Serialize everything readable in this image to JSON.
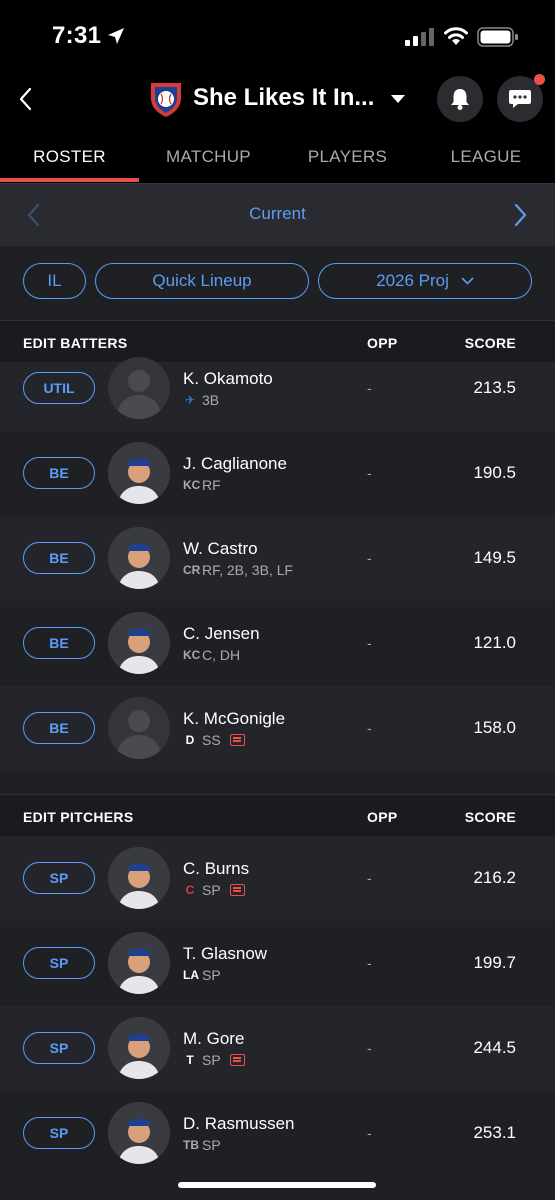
{
  "status_bar": {
    "time": "7:31"
  },
  "header": {
    "team_name": "She Likes It In..."
  },
  "tabs": [
    {
      "label": "ROSTER",
      "active": true
    },
    {
      "label": "MATCHUP",
      "active": false
    },
    {
      "label": "PLAYERS",
      "active": false
    },
    {
      "label": "LEAGUE",
      "active": false
    }
  ],
  "period": {
    "label": "Current"
  },
  "controls": {
    "il": "IL",
    "quick_lineup": "Quick Lineup",
    "projection": "2026 Proj"
  },
  "batters": {
    "header": {
      "title": "EDIT BATTERS",
      "opp": "OPP",
      "score": "SCORE"
    },
    "rows": [
      {
        "slot": "UTIL",
        "name": "K. Okamoto",
        "team": "TOR",
        "positions": "3B",
        "opp": "-",
        "score": "213.5",
        "news": false,
        "photo": false
      },
      {
        "slot": "BE",
        "name": "J. Caglianone",
        "team": "KC",
        "positions": "RF",
        "opp": "-",
        "score": "190.5",
        "news": false,
        "photo": true
      },
      {
        "slot": "BE",
        "name": "W. Castro",
        "team": "COL",
        "positions": "RF, 2B, 3B, LF",
        "opp": "-",
        "score": "149.5",
        "news": false,
        "photo": true
      },
      {
        "slot": "BE",
        "name": "C. Jensen",
        "team": "KC",
        "positions": "C, DH",
        "opp": "-",
        "score": "121.0",
        "news": false,
        "photo": true
      },
      {
        "slot": "BE",
        "name": "K. McGonigle",
        "team": "DET",
        "positions": "SS",
        "opp": "-",
        "score": "158.0",
        "news": true,
        "photo": false
      }
    ]
  },
  "pitchers": {
    "header": {
      "title": "EDIT PITCHERS",
      "opp": "OPP",
      "score": "SCORE"
    },
    "rows": [
      {
        "slot": "SP",
        "name": "C. Burns",
        "team": "CIN",
        "positions": "SP",
        "opp": "-",
        "score": "216.2",
        "news": true,
        "photo": true
      },
      {
        "slot": "SP",
        "name": "T. Glasnow",
        "team": "LA",
        "positions": "SP",
        "opp": "-",
        "score": "199.7",
        "news": false,
        "photo": true
      },
      {
        "slot": "SP",
        "name": "M. Gore",
        "team": "TEX",
        "positions": "SP",
        "opp": "-",
        "score": "244.5",
        "news": true,
        "photo": true
      },
      {
        "slot": "SP",
        "name": "D. Rasmussen",
        "team": "TB",
        "positions": "SP",
        "opp": "-",
        "score": "253.1",
        "news": false,
        "photo": true
      }
    ]
  },
  "colors": {
    "accent": "#5b9cf6",
    "alert": "#e8504a",
    "background": "#1f2023"
  }
}
